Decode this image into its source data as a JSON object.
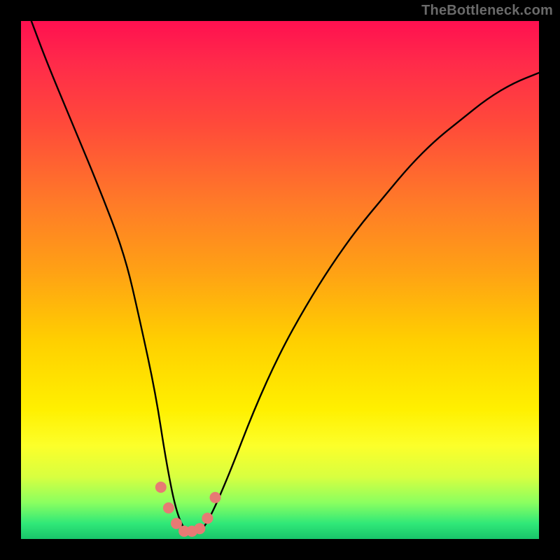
{
  "watermark": "TheBottleneck.com",
  "chart_data": {
    "type": "line",
    "title": "",
    "xlabel": "",
    "ylabel": "",
    "xlim": [
      0,
      100
    ],
    "ylim": [
      0,
      100
    ],
    "series": [
      {
        "name": "bottleneck-curve",
        "x": [
          2,
          5,
          10,
          15,
          20,
          23,
          26,
          28,
          30,
          32,
          34,
          36,
          40,
          45,
          50,
          55,
          60,
          65,
          70,
          75,
          80,
          85,
          90,
          95,
          100
        ],
        "values": [
          100,
          92,
          80,
          68,
          55,
          42,
          28,
          15,
          5,
          1,
          1,
          3,
          12,
          25,
          36,
          45,
          53,
          60,
          66,
          72,
          77,
          81,
          85,
          88,
          90
        ]
      }
    ],
    "annotations": [
      {
        "name": "minimum-highlight",
        "x": [
          27,
          28.5,
          30,
          31.5,
          33,
          34.5,
          36,
          37.5
        ],
        "y": [
          10,
          6,
          3,
          1.5,
          1.5,
          2,
          4,
          8
        ]
      }
    ],
    "gradient_stops": [
      {
        "pct": 0,
        "color": "#ff1050"
      },
      {
        "pct": 20,
        "color": "#ff4a3a"
      },
      {
        "pct": 48,
        "color": "#ffa015"
      },
      {
        "pct": 75,
        "color": "#fff000"
      },
      {
        "pct": 93,
        "color": "#8aff60"
      },
      {
        "pct": 100,
        "color": "#18c56a"
      }
    ]
  }
}
